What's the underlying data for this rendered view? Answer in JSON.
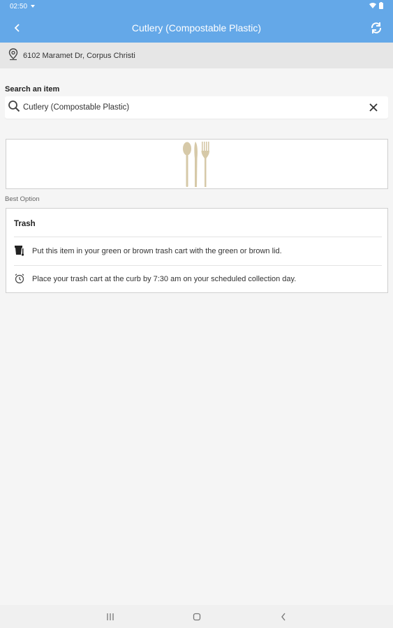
{
  "status_bar": {
    "time": "02:50"
  },
  "app_bar": {
    "title": "Cutlery (Compostable Plastic)"
  },
  "address": {
    "text": "6102 Maramet Dr, Corpus Christi"
  },
  "search": {
    "label": "Search an item",
    "value": "Cutlery (Compostable Plastic)"
  },
  "best_option": {
    "label": "Best Option"
  },
  "card": {
    "title": "Trash",
    "rows": [
      {
        "icon": "trash-cart-icon",
        "text": "Put this item in your green or brown trash cart with the green or brown lid."
      },
      {
        "icon": "alarm-clock-icon",
        "text": "Place your trash cart at the curb by 7:30 am on your scheduled collection day."
      }
    ]
  },
  "colors": {
    "accent": "#64a8e8",
    "background": "#f5f5f5",
    "address_bar": "#e6e6e6",
    "cutlery": "#d6c9a8"
  }
}
